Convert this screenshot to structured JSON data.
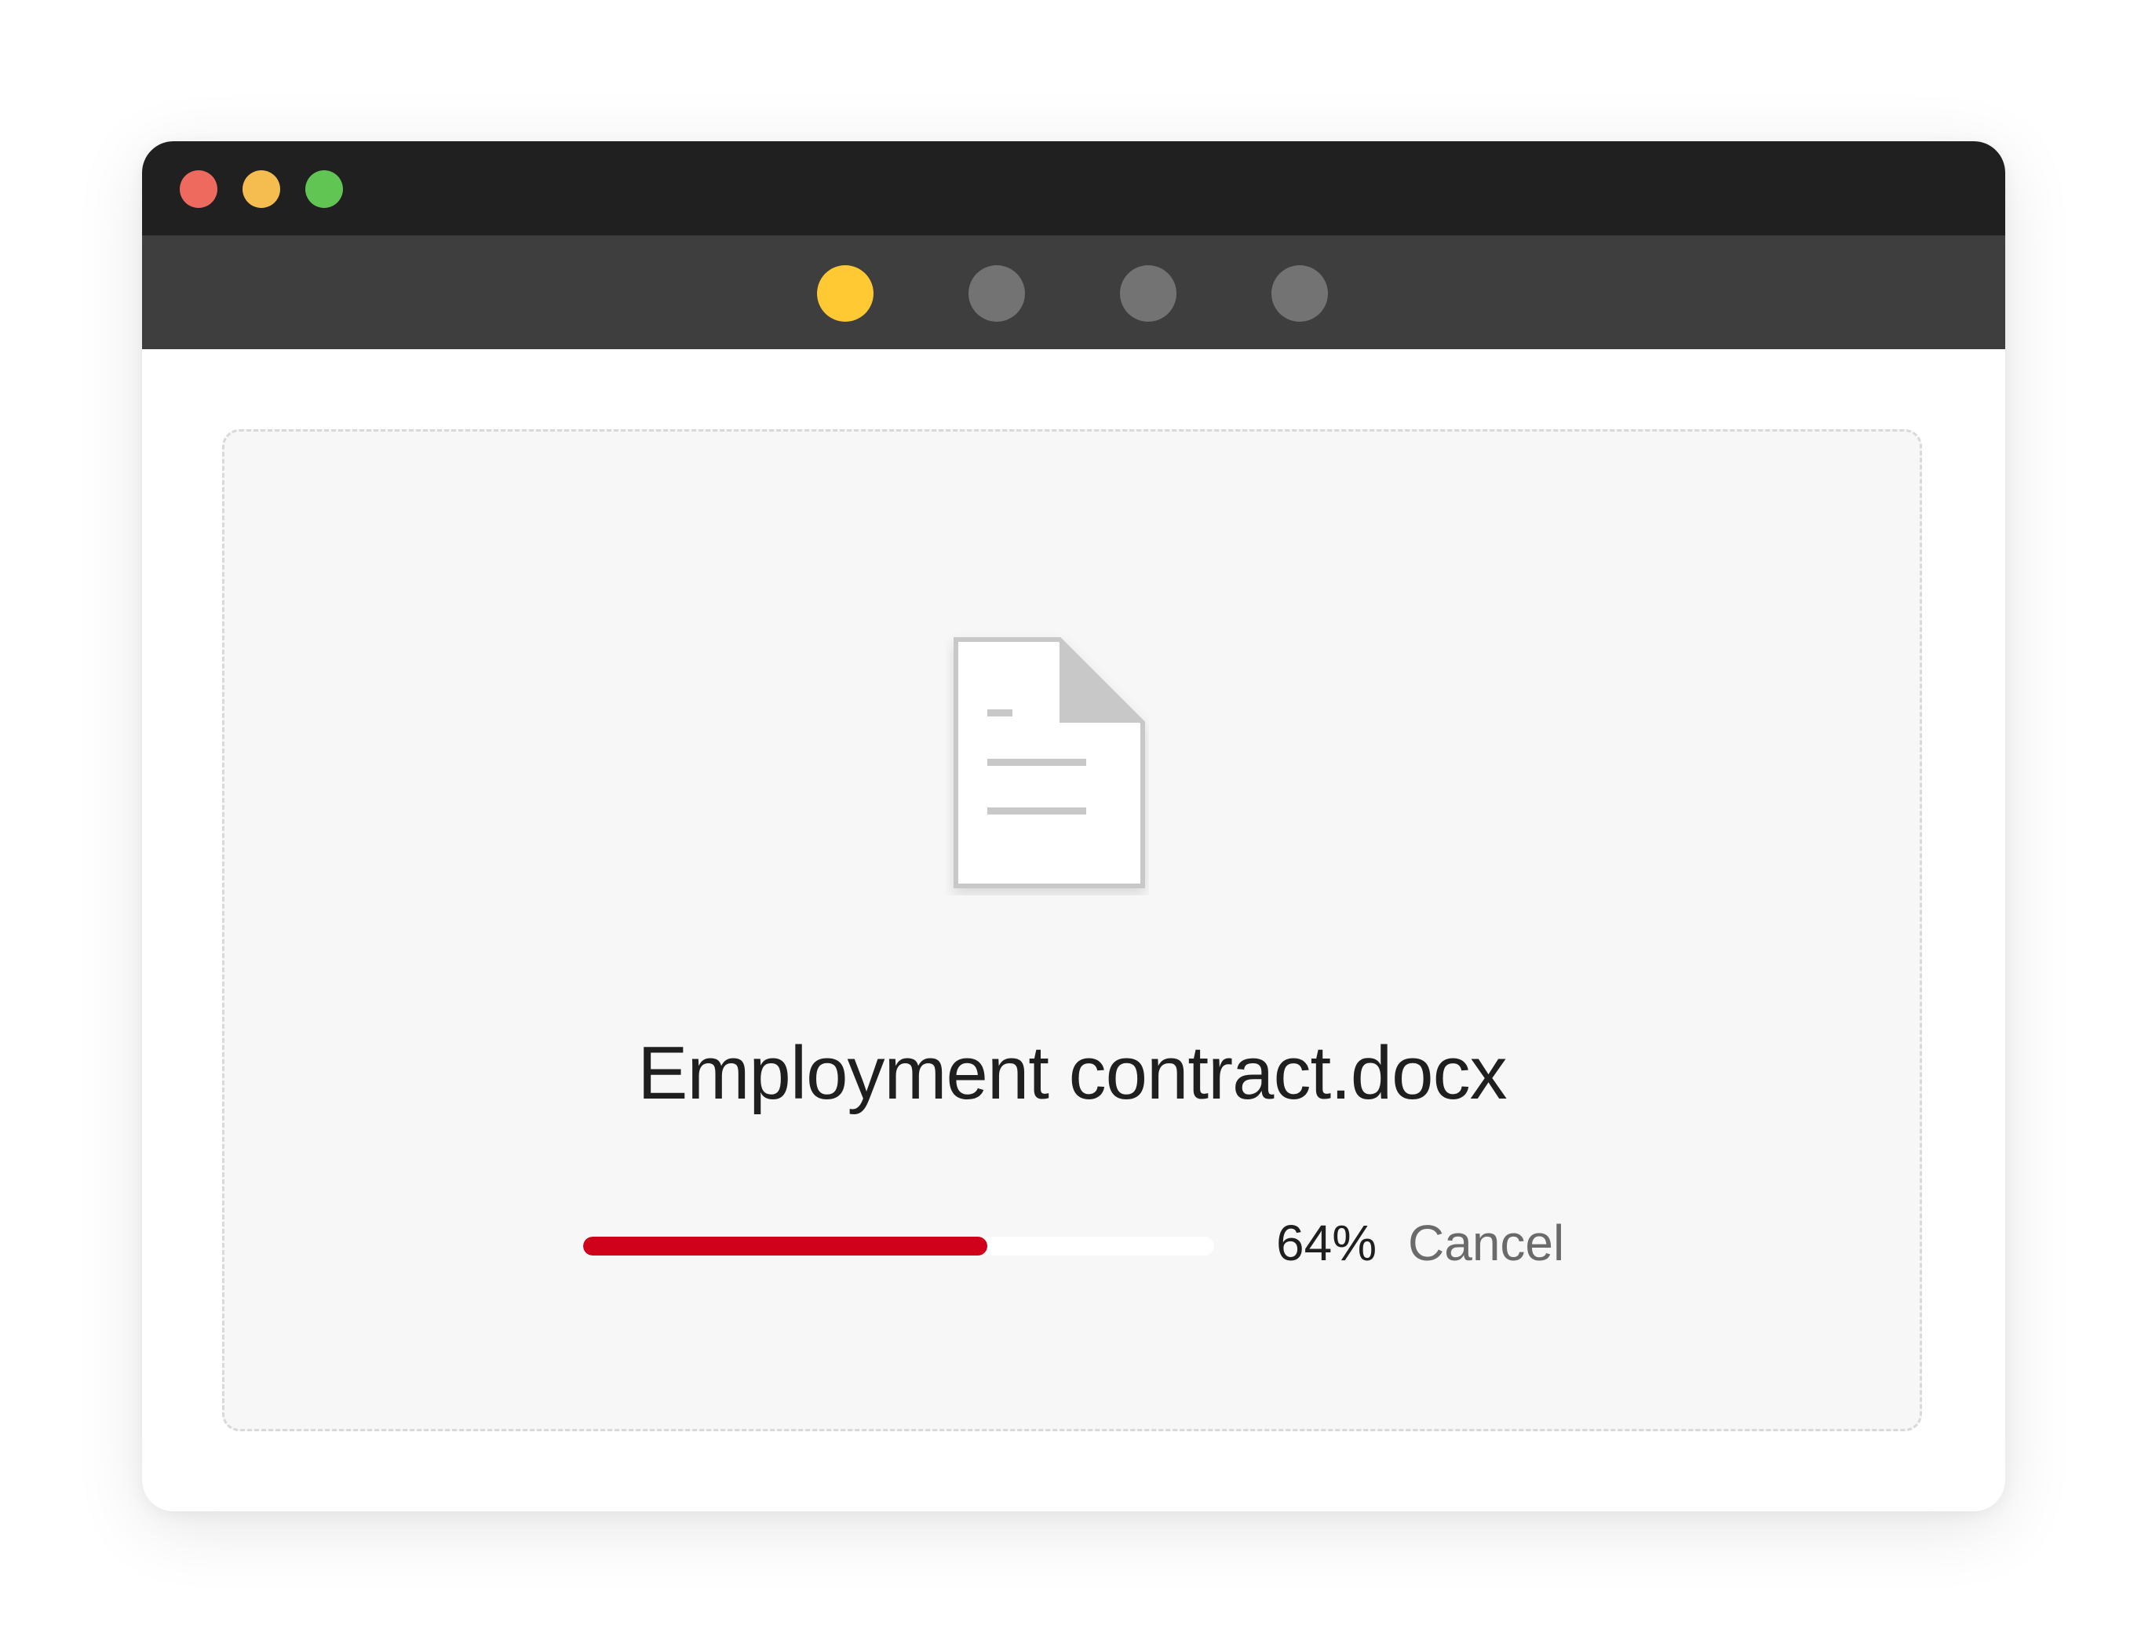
{
  "window": {
    "traffic_lights": [
      {
        "name": "close",
        "color": "#ee6a5f"
      },
      {
        "name": "minimize",
        "color": "#f5bd4f"
      },
      {
        "name": "maximize",
        "color": "#61c554"
      }
    ]
  },
  "toolbar": {
    "steps": [
      {
        "state": "active",
        "color": "#ffc933"
      },
      {
        "state": "inactive",
        "color": "#737373"
      },
      {
        "state": "inactive",
        "color": "#737373"
      },
      {
        "state": "inactive",
        "color": "#737373"
      }
    ]
  },
  "upload": {
    "icon": "document-icon",
    "filename": "Employment contract.docx",
    "progress_percent": 64,
    "progress_label": "64%",
    "cancel_label": "Cancel",
    "progress_color": "#d0021b"
  }
}
